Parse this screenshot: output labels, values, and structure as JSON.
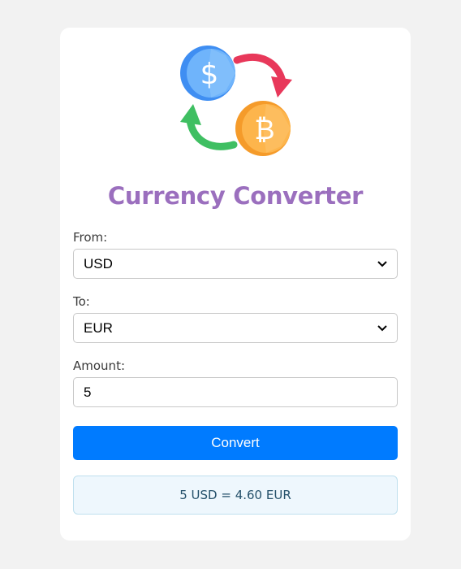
{
  "app": {
    "title": "Currency Converter"
  },
  "logo": {
    "icon": "currency-exchange-icon",
    "coins": [
      "dollar-coin-icon",
      "bitcoin-coin-icon"
    ],
    "colors": {
      "dollar_coin": "#5ea9f7",
      "bitcoin_coin": "#fbb244",
      "arrow_top": "#e8385a",
      "arrow_bottom": "#3fbf62"
    }
  },
  "form": {
    "from": {
      "label": "From:",
      "value": "USD"
    },
    "to": {
      "label": "To:",
      "value": "EUR"
    },
    "amount": {
      "label": "Amount:",
      "value": "5"
    },
    "convert_label": "Convert"
  },
  "result": {
    "text": "5 USD = 4.60 EUR"
  },
  "colors": {
    "accent": "#007bff",
    "title": "#9b6fbe",
    "result_bg": "#eef7fd",
    "result_text": "#24506a"
  }
}
